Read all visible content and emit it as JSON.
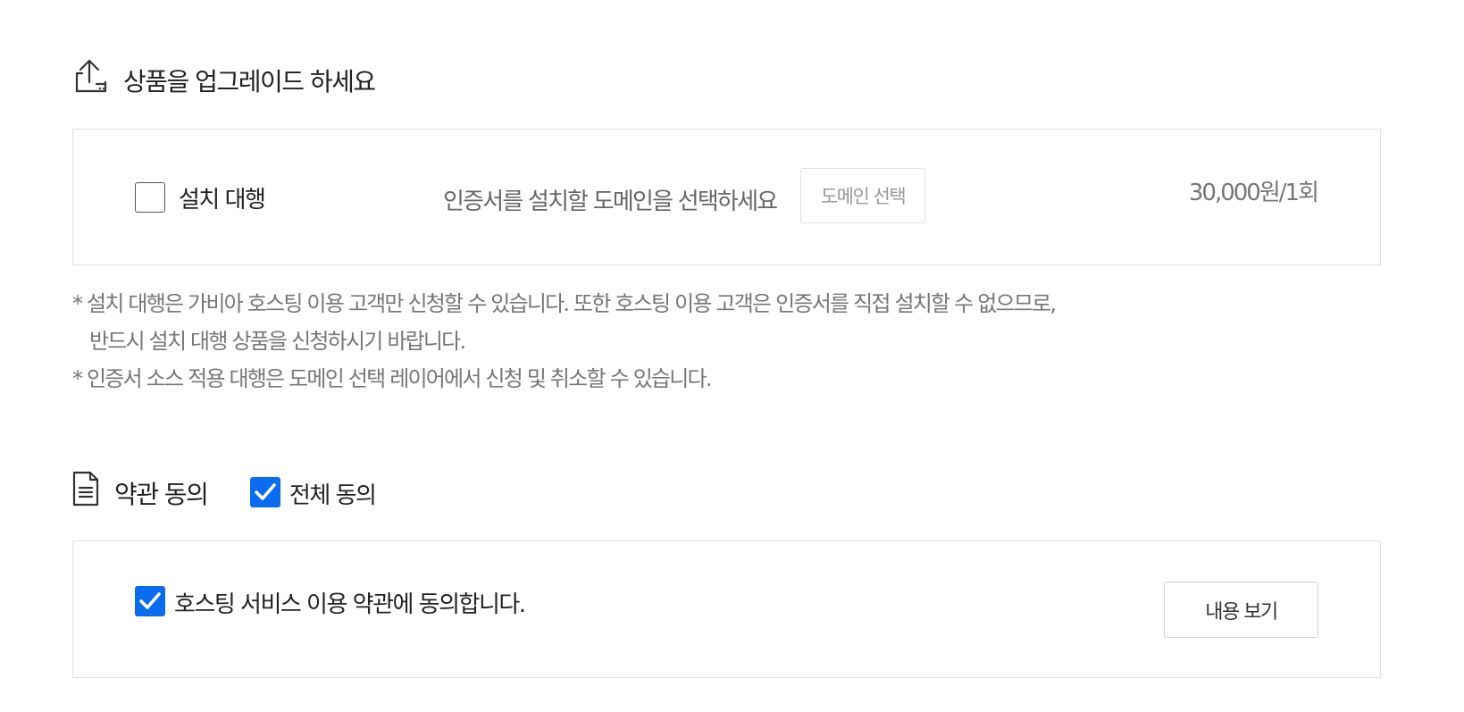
{
  "upgrade": {
    "title": "상품을 업그레이드 하세요",
    "icon": "upload-box-icon",
    "option": {
      "label": "설치 대행",
      "checked": false,
      "hint": "인증서를 설치할 도메인을 선택하세요",
      "domain_button": "도메인 선택",
      "price": "30,000원/1회"
    },
    "notes": [
      "* 설치 대행은 가비아 호스팅 이용 고객만 신청할 수 있습니다. 또한 호스팅 이용 고객은 인증서를 직접 설치할 수 없으므로,",
      "반드시 설치 대행 상품을 신청하시기 바랍니다.",
      "* 인증서 소스 적용 대행은 도메인 선택 레이어에서 신청 및 취소할 수 있습니다."
    ]
  },
  "terms": {
    "title": "약관 동의",
    "icon": "document-icon",
    "agree_all": {
      "label": "전체 동의",
      "checked": true
    },
    "items": [
      {
        "label": "호스팅 서비스 이용 약관에 동의합니다.",
        "checked": true,
        "view_button": "내용 보기"
      }
    ]
  },
  "colors": {
    "checkbox_checked": "#0a6cf0",
    "border": "#e2e2e2",
    "muted_text": "#777777"
  }
}
